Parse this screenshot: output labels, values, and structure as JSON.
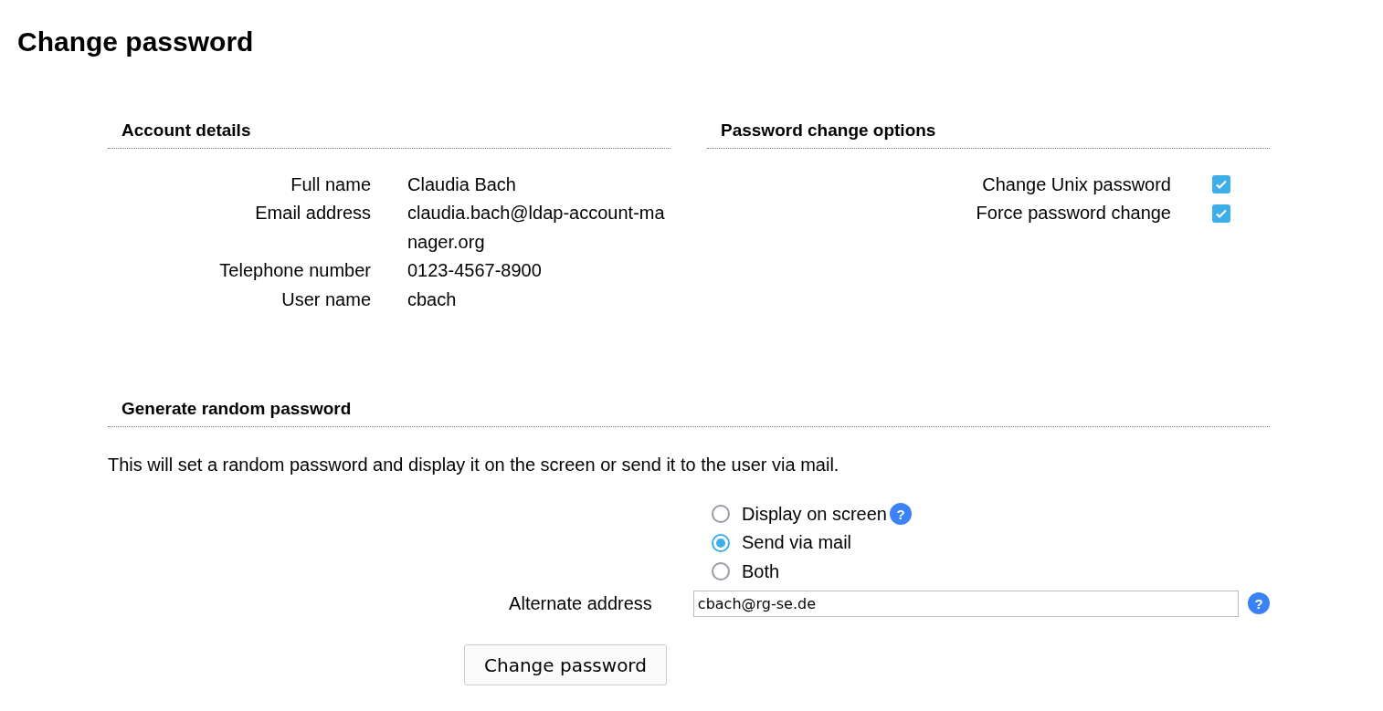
{
  "title": "Change password",
  "account_details": {
    "heading": "Account details",
    "rows": [
      {
        "label": "Full name",
        "value": "Claudia Bach"
      },
      {
        "label": "Email address",
        "value": "claudia.bach@ldap-account-manager.org"
      },
      {
        "label": "Telephone number",
        "value": "0123-4567-8900"
      },
      {
        "label": "User name",
        "value": "cbach"
      }
    ]
  },
  "password_change_options": {
    "heading": "Password change options",
    "options": [
      {
        "label": "Change Unix password",
        "checked": true
      },
      {
        "label": "Force password change",
        "checked": true
      }
    ]
  },
  "generate_random_password": {
    "heading": "Generate random password",
    "description": "This will set a random password and display it on the screen or send it to the user via mail.",
    "delivery": [
      {
        "label": "Display on screen",
        "selected": false,
        "help": "?"
      },
      {
        "label": "Send via mail",
        "selected": true
      },
      {
        "label": "Both",
        "selected": false
      }
    ],
    "alternate_address": {
      "label": "Alternate address",
      "value": "cbach@rg-se.de",
      "help": "?"
    },
    "submit": "Change password"
  }
}
